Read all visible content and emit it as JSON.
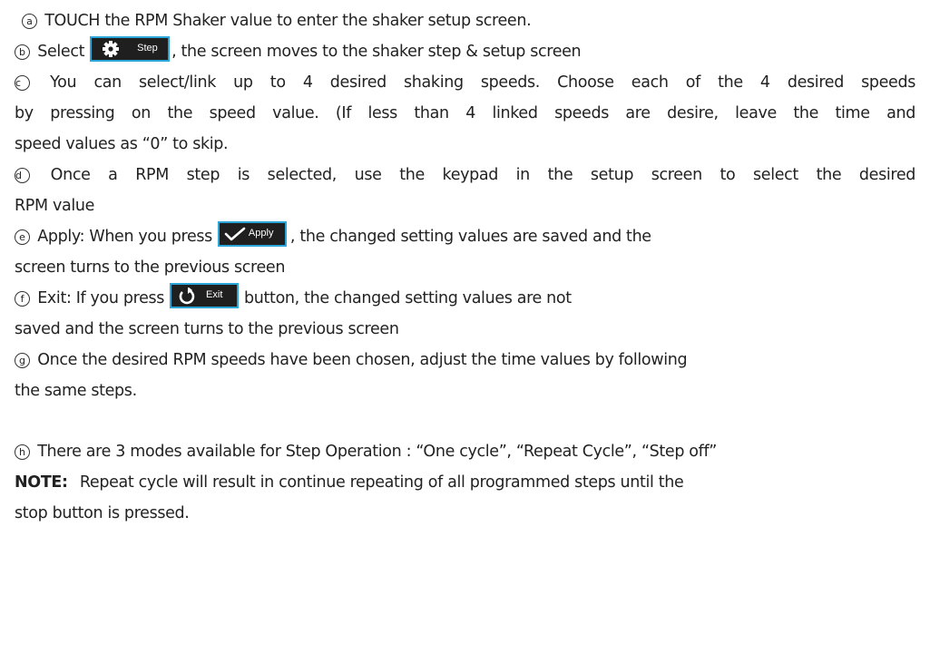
{
  "steps": {
    "a": {
      "marker": "a",
      "text": "TOUCH the RPM Shaker value to enter the shaker setup screen."
    },
    "b": {
      "marker": "b",
      "before": "Select",
      "button_label": "Step",
      "after": ", the screen moves to the shaker step & setup screen"
    },
    "c": {
      "marker": "c",
      "line1": "You can select/link up to 4 desired shaking speeds.   Choose each of the 4 desired speeds",
      "line2": "by pressing on the speed value.   (If less than 4 linked speeds are desire, leave the time and",
      "line3": "speed values as “0” to skip."
    },
    "d": {
      "marker": "d",
      "line1": "Once a RPM step is selected, use the keypad in the setup screen to select the desired",
      "line2": "RPM value"
    },
    "e": {
      "marker": "e",
      "before": "Apply: When you press",
      "button_label": "Apply",
      "after": ",   the changed setting values are saved and the",
      "line2": "screen turns to the previous screen"
    },
    "f": {
      "marker": "f",
      "before": "Exit: If you press",
      "button_label": "Exit",
      "after": "button, the changed setting values are not",
      "line2": "saved and the screen turns to the previous screen"
    },
    "g": {
      "marker": "g",
      "line1": "Once the desired RPM speeds have been chosen, adjust the time values by following",
      "line2": "the same steps."
    },
    "h": {
      "marker": "h",
      "text": "There are 3 modes available for Step Operation : “One cycle”, “Repeat Cycle”, “Step off”"
    }
  },
  "note": {
    "label": "NOTE:",
    "line1": "Repeat cycle will result in continue repeating of all programmed steps until the",
    "line2": "stop button is pressed."
  },
  "icons": {
    "step_button": "gear-icon",
    "apply_button": "checkmark-icon",
    "exit_button": "undo-arrow-icon"
  },
  "colors": {
    "button_background": "#1f1f1f",
    "button_border": "#2aa6d8",
    "icon_color": "#ffffff"
  }
}
